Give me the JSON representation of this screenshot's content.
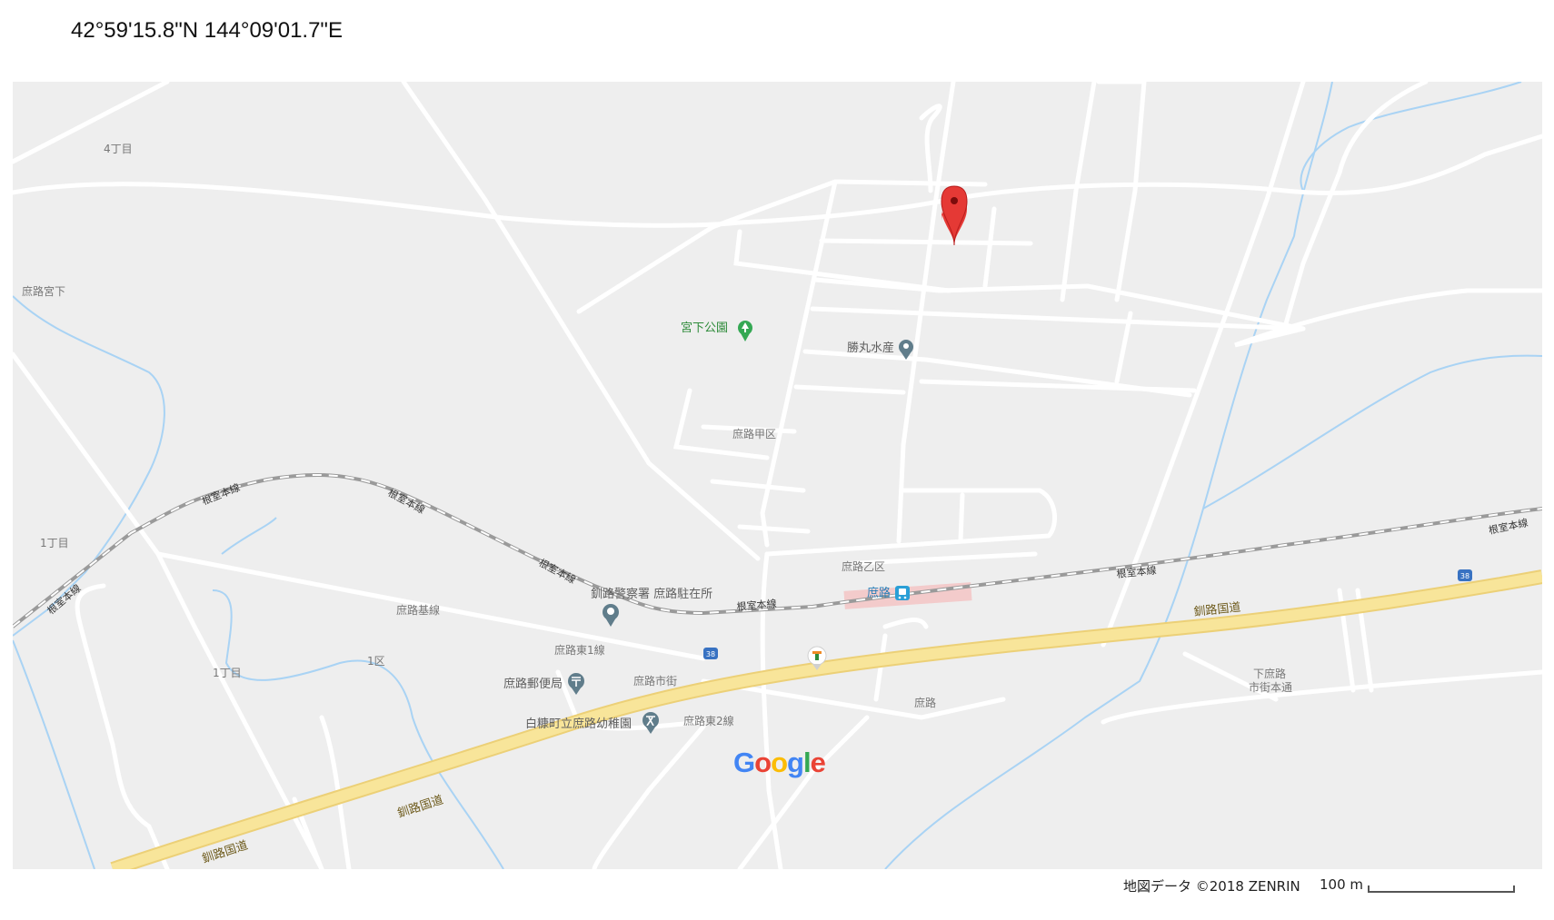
{
  "header": {
    "coordinates": "42°59'15.8\"N 144°09'01.7\"E"
  },
  "map": {
    "places": {
      "yon_chome": "4丁目",
      "shoro_miyashita": "庶路宮下",
      "miyashita_park": "宮下公園",
      "katsumaru_suisan": "勝丸水産",
      "shoro_kouku": "庶路甲区",
      "shoro_otsuku": "庶路乙区",
      "ichi_chome_left": "1丁目",
      "ichi_chome_mid": "1丁目",
      "ikku": "1区",
      "shoro_kisen": "庶路基線",
      "shoro_higashi1": "庶路東1線",
      "shoro_higashi2": "庶路東2線",
      "police": "釧路警察署 庶路駐在所",
      "post_office": "庶路郵便局",
      "kindergarten": "白糠町立庶路幼稚園",
      "shoro_shigai": "庶路市街",
      "shoro": "庶路",
      "station": "庶路",
      "shimo_shoro_1": "下庶路",
      "shimo_shoro_2": "市街本通"
    },
    "rail_labels": [
      "根室本線",
      "根室本線",
      "根室本線",
      "根室本線",
      "根室本線",
      "根室本線",
      "根室本線"
    ],
    "highway_labels": [
      "釧路国道",
      "釧路国道",
      "釧路国道"
    ],
    "route_shield": "38",
    "brand": "Google",
    "icons": [
      "map-pin-icon",
      "park-tree-icon",
      "place-pin-icon",
      "station-icon",
      "post-office-icon",
      "school-icon",
      "convenience-store-icon",
      "route-38-shield-icon"
    ],
    "colors": {
      "road": "#ffffff",
      "highway": "#f8e59a",
      "highway_edge": "#ecd077",
      "water": "#a9d3f4",
      "railway": "#9a9a9a",
      "pin": "#e53935",
      "park": "#34a853",
      "poi": "#607d8b",
      "land": "#eeeeee"
    }
  },
  "footer": {
    "attribution": "地図データ ©2018 ZENRIN",
    "scale_label": "100 m"
  }
}
